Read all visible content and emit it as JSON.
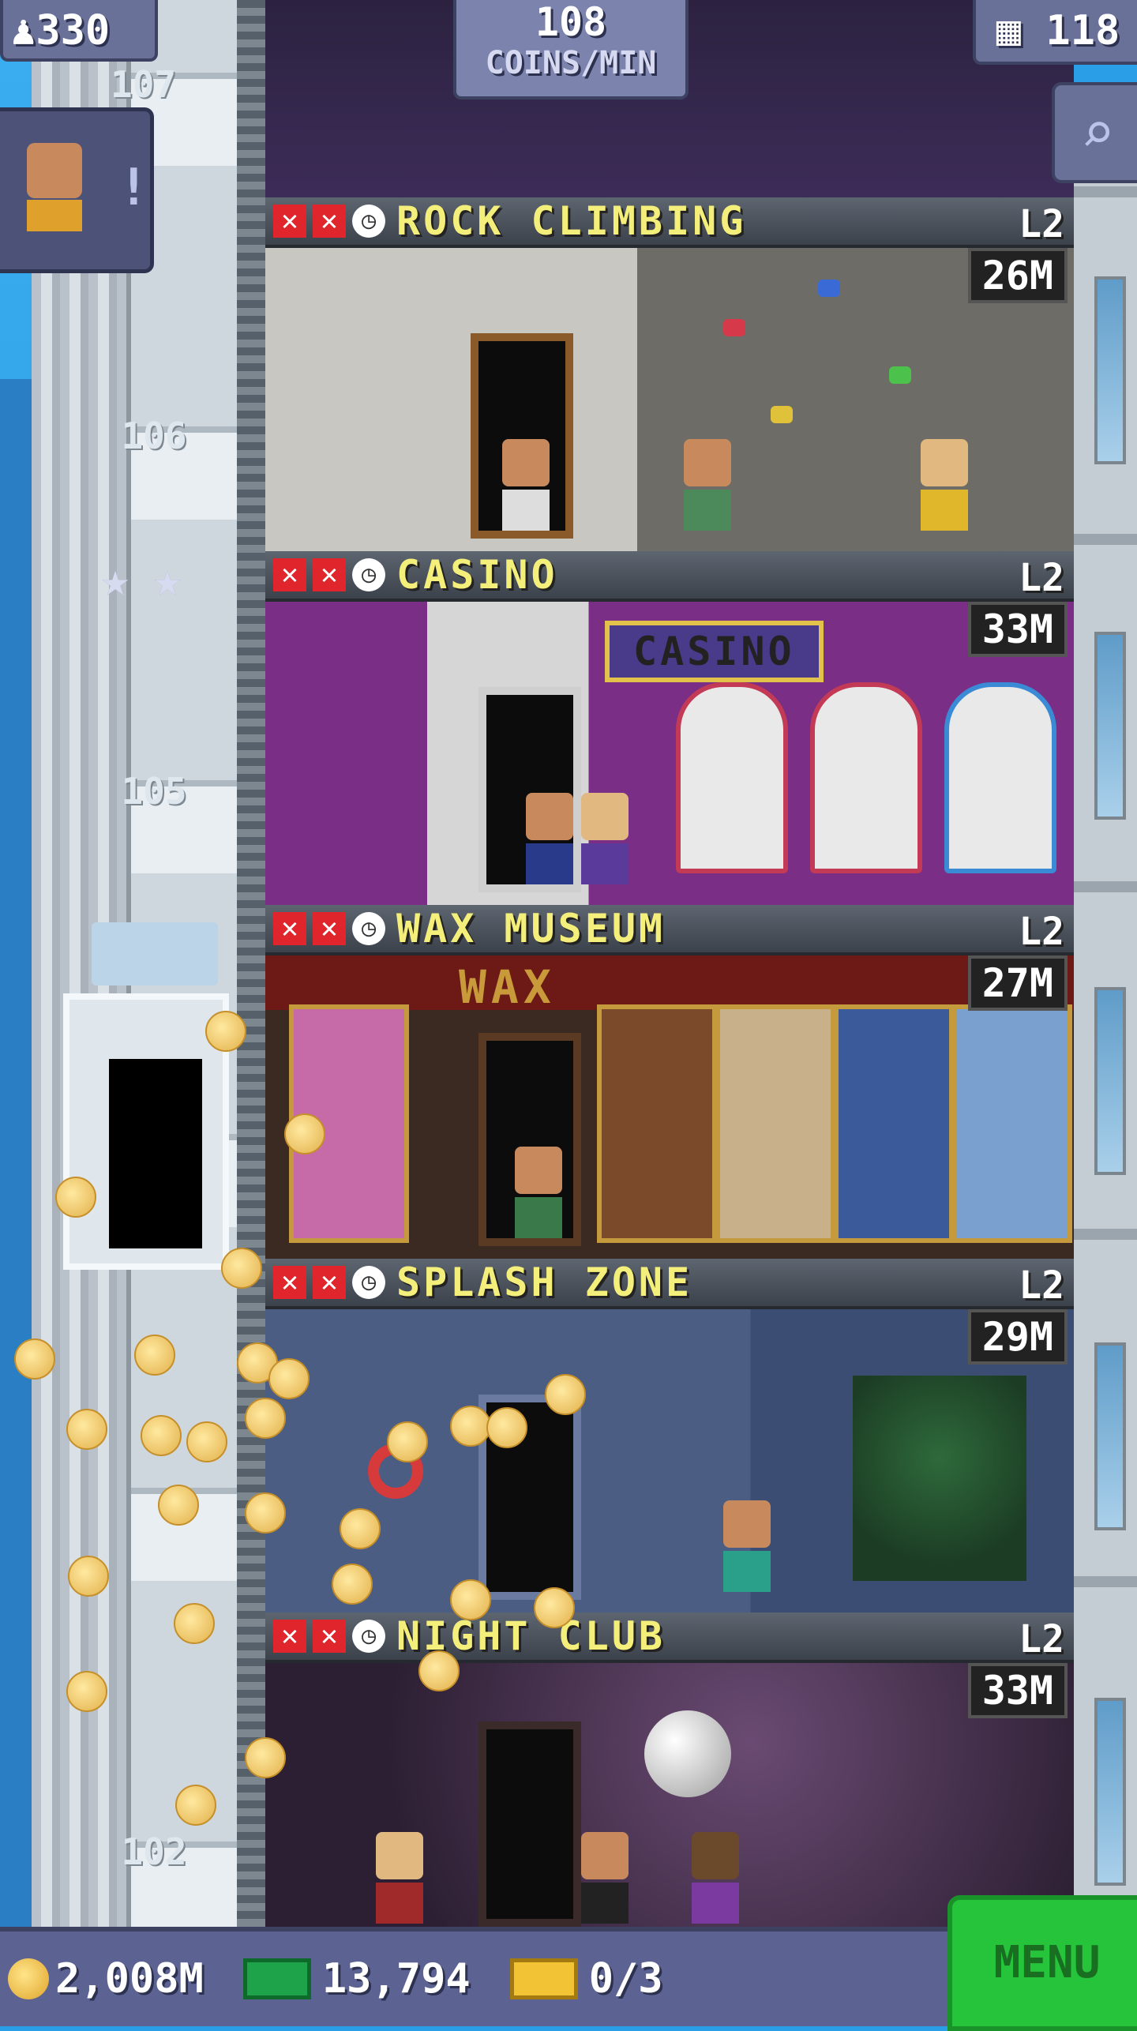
{
  "header": {
    "population": "330",
    "rate_value": "108",
    "rate_unit": "COINS/MIN",
    "floor_count": "118",
    "current_floor_label": "107"
  },
  "shaft_labels": [
    "106",
    "105",
    "102"
  ],
  "floors": [
    {
      "name": "ROCK CLIMBING",
      "level": "L2",
      "coins": "26M"
    },
    {
      "name": "CASINO",
      "level": "L2",
      "coins": "33M",
      "sign": "CASINO"
    },
    {
      "name": "WAX MUSEUM",
      "level": "L2",
      "coins": "27M",
      "sign": "WAX"
    },
    {
      "name": "SPLASH ZONE",
      "level": "L2",
      "coins": "29M"
    },
    {
      "name": "NIGHT CLUB",
      "level": "L2",
      "coins": "33M"
    }
  ],
  "bottom_bar": {
    "coins": "2,008M",
    "bux": "13,794",
    "tickets": "0/3",
    "menu_label": "MENU"
  },
  "icons": {
    "population": "person-icon",
    "floors": "building-icon",
    "search": "magnifier-icon",
    "bad_status": "x-icon",
    "timer": "clock-icon",
    "coin": "coin-icon",
    "bux": "bux-icon",
    "ticket": "ticket-icon"
  },
  "colors": {
    "floor_name": "#f4ee7a",
    "bad_status": "#e0262c",
    "menu": "#26c43a",
    "bar": "#5c6392"
  }
}
